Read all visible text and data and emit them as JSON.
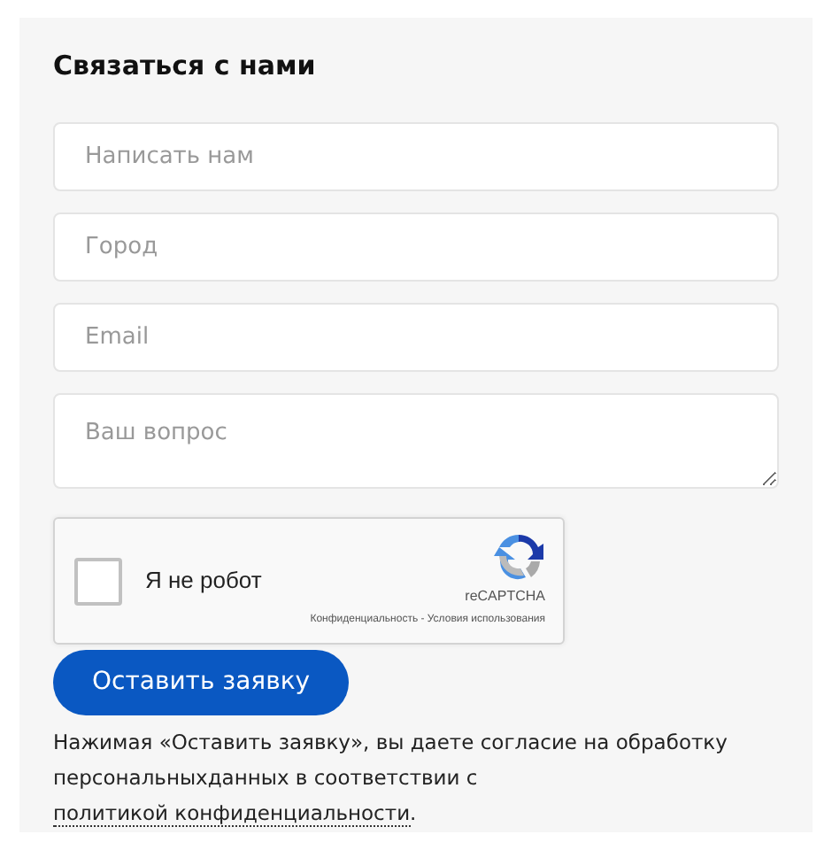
{
  "title": "Связаться с нами",
  "fields": [
    {
      "kind": "input",
      "placeholder": "Написать нам"
    },
    {
      "kind": "input",
      "placeholder": "Город"
    },
    {
      "kind": "input",
      "placeholder": "Email"
    },
    {
      "kind": "textarea",
      "placeholder": "Ваш вопрос"
    }
  ],
  "captcha": {
    "label": "Я не робот",
    "checked": false,
    "brand": "reCAPTCHA",
    "links": "Конфиденциальность - Условия использования"
  },
  "submit": "Оставить заявку",
  "consent": {
    "text": "Нажимая «Оставить заявку», вы даете согласие на обработку персональныхданных в соответствии с",
    "link": "политикой конфиденциальности",
    "after": "."
  }
}
